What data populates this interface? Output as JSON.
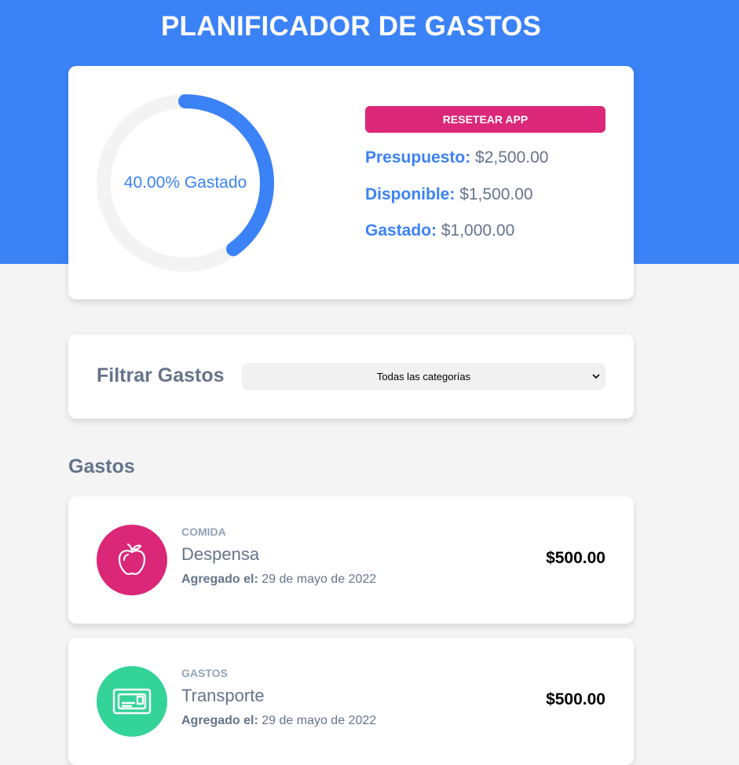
{
  "app": {
    "title": "PLANIFICADOR DE GASTOS"
  },
  "budget": {
    "progress_percent": 40,
    "progress_text": "40.00% Gastado",
    "reset_label": "RESETEAR APP",
    "presupuesto_label": "Presupuesto:",
    "presupuesto_value": "$2,500.00",
    "disponible_label": "Disponible:",
    "disponible_value": "$1,500.00",
    "gastado_label": "Gastado:",
    "gastado_value": "$1,000.00"
  },
  "filter": {
    "label": "Filtrar Gastos",
    "selected": "Todas las categorías"
  },
  "expenses": {
    "title": "Gastos",
    "items": [
      {
        "category": "COMIDA",
        "name": "Despensa",
        "date_label": "Agregado el:",
        "date": "29 de mayo de 2022",
        "amount": "$500.00",
        "icon": "apple-icon",
        "color": "#db2777"
      },
      {
        "category": "GASTOS",
        "name": "Transporte",
        "date_label": "Agregado el:",
        "date": "29 de mayo de 2022",
        "amount": "$500.00",
        "icon": "card-icon",
        "color": "#34d399"
      }
    ]
  },
  "colors": {
    "primary": "#3b82f6",
    "accent": "#db2777",
    "text": "#64748b",
    "background": "#f4f4f4"
  }
}
